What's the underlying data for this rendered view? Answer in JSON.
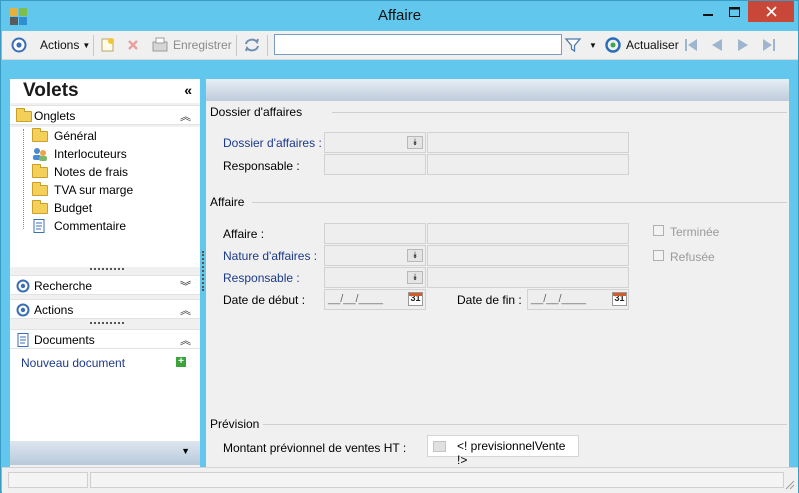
{
  "window": {
    "title": "Affaire",
    "minimize_icon": "minimize-icon",
    "maximize_icon": "maximize-icon",
    "close_icon": "close-icon",
    "accent_color": "#62c7ec"
  },
  "toolbar": {
    "actions_label": "Actions",
    "save_label": "Enregistrer",
    "refresh_label": "Actualiser",
    "search_value": ""
  },
  "left_panel": {
    "title": "Volets",
    "onglets": {
      "label": "Onglets",
      "items": [
        {
          "label": "Général",
          "icon": "folder-icon"
        },
        {
          "label": "Interlocuteurs",
          "icon": "people-icon"
        },
        {
          "label": "Notes de frais",
          "icon": "folder-icon"
        },
        {
          "label": "TVA sur marge",
          "icon": "folder-icon"
        },
        {
          "label": "Budget",
          "icon": "folder-icon"
        },
        {
          "label": "Commentaire",
          "icon": "document-icon"
        }
      ]
    },
    "recherche_label": "Recherche",
    "actions_label": "Actions",
    "documents": {
      "label": "Documents",
      "new_document_label": "Nouveau document"
    }
  },
  "form": {
    "dossier": {
      "section_title": "Dossier d'affaires",
      "dossier_label": "Dossier d'affaires :",
      "dossier_value": "",
      "responsable_label": "Responsable :",
      "responsable_value": ""
    },
    "affaire": {
      "section_title": "Affaire",
      "affaire_label": "Affaire :",
      "affaire_value": "",
      "nature_label": "Nature d'affaires :",
      "nature_value": "",
      "responsable_label": "Responsable :",
      "responsable_value": "",
      "date_debut_label": "Date de début :",
      "date_debut_value": "__/__/____",
      "date_fin_label": "Date de fin :",
      "date_fin_value": "__/__/____",
      "terminee_label": "Terminée",
      "terminee_checked": false,
      "refusee_label": "Refusée",
      "refusee_checked": false
    },
    "prevision": {
      "section_title": "Prévision",
      "montant_label": "Montant prévionnel de ventes HT :",
      "montant_value": "<! previsionnelVente !>"
    }
  }
}
